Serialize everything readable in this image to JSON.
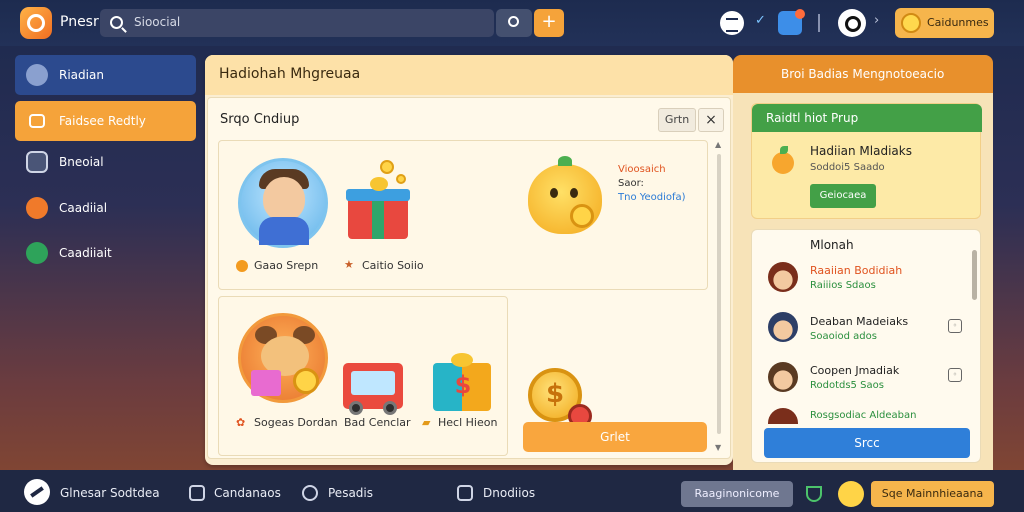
{
  "topbar": {
    "app_name": "Pnesr",
    "search_text": "Sioocial",
    "plus_label": "+",
    "coins_label": "Caidunmes"
  },
  "sidebar": {
    "items": [
      {
        "label": "Riadian",
        "active": true,
        "color": "#2c4a8e"
      },
      {
        "label": "Faidsee Redtly",
        "highlight": true,
        "color": "#f5a33a"
      },
      {
        "label": "Bneoial"
      },
      {
        "label": "Caadiial"
      },
      {
        "label": "Caadiiait"
      }
    ]
  },
  "center": {
    "title": "Hadiohah Mhgreuaa",
    "dialog": {
      "title": "Srqo Cndiup",
      "btn_label": "Grtn",
      "close_label": "×",
      "items_row1": [
        {
          "label": "Gaao Srepn"
        },
        {
          "label": "Caitio Soiio"
        }
      ],
      "promo": {
        "line1": "Vioosaich",
        "line2": "Saor:",
        "line3": "Tno Yeodiofa)"
      },
      "items_row2": [
        {
          "label": "Sogeas Dordan"
        },
        {
          "label": "Bad Cenclar"
        },
        {
          "label": "Hecl Hieon"
        }
      ],
      "coin_symbol": "$",
      "get_button": "Grlet"
    }
  },
  "right": {
    "title": "Broi Badias Mengnotoeacio",
    "card1": {
      "title": "Raidtl hiot Prup",
      "name": "Hadiian Mladiaks",
      "sub": "Soddoi5 Saado",
      "button": "Geiocaea"
    },
    "card2": {
      "title": "Mlonah",
      "rows": [
        {
          "name": "Raaiian Bodidiah",
          "sub": "Raiiios Sdaos"
        },
        {
          "name": "Deaban Madeiaks",
          "sub": "Soaoiod ados"
        },
        {
          "name": "Coopen Jmadiak",
          "sub": "Rodotds5 Saos"
        },
        {
          "name": "Rosgsodiac Aldeaban",
          "sub": ""
        }
      ],
      "button": "Srcc"
    }
  },
  "bottombar": {
    "item1": "Glnesar Sodtdea",
    "item2": "Candanaos",
    "item3": "Pesadis",
    "item4": "Dnodiios",
    "pill": "Raaginonicome",
    "cta": "Sqe Mainnhieaana"
  },
  "colors": {
    "accent_orange": "#f5a33a",
    "accent_green": "#43a047",
    "accent_blue": "#2f7fd9",
    "topbar_bg": "#1d2b4f"
  }
}
